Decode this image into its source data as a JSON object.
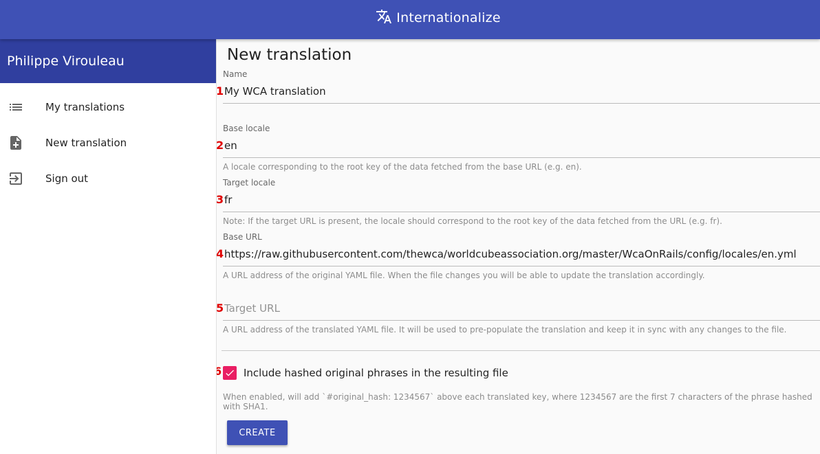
{
  "header": {
    "app_title": "Internationalize",
    "icon": "translate-icon",
    "color": "#3f51b5"
  },
  "drawer": {
    "user_name": "Philippe Virouleau",
    "header_color": "#303f9f",
    "items": [
      {
        "label": "My translations",
        "icon": "list-icon"
      },
      {
        "label": "New translation",
        "icon": "note-add-icon"
      },
      {
        "label": "Sign out",
        "icon": "exit-icon"
      }
    ]
  },
  "form": {
    "title": "New translation",
    "markers": [
      "1",
      "2",
      "3",
      "4",
      "5",
      "6"
    ],
    "name": {
      "label": "Name",
      "value": "My WCA translation"
    },
    "base_locale": {
      "label": "Base locale",
      "value": "en",
      "help": "A locale corresponding to the root key of the data fetched from the base URL (e.g. en)."
    },
    "target_locale": {
      "label": "Target locale",
      "value": "fr",
      "help": "Note: If the target URL is present, the locale should correspond to the root key of the data fetched from the URL (e.g. fr)."
    },
    "base_url": {
      "label": "Base URL",
      "value": "https://raw.githubusercontent.com/thewca/worldcubeassociation.org/master/WcaOnRails/config/locales/en.yml",
      "help": "A URL address of the original YAML file. When the file changes you will be able to update the translation accordingly."
    },
    "target_url": {
      "placeholder": "Target URL",
      "value": "",
      "help": "A URL address of the translated YAML file. It will be used to pre-populate the translation and keep it in sync with any changes to the file."
    },
    "include_hash": {
      "label": "Include hashed original phrases in the resulting file",
      "checked": true,
      "color": "#e91e63",
      "help": "When enabled, will add `#original_hash: 1234567` above each translated key, where 1234567 are the first 7 characters of the phrase hashed with SHA1."
    },
    "create_label": "CREATE"
  }
}
